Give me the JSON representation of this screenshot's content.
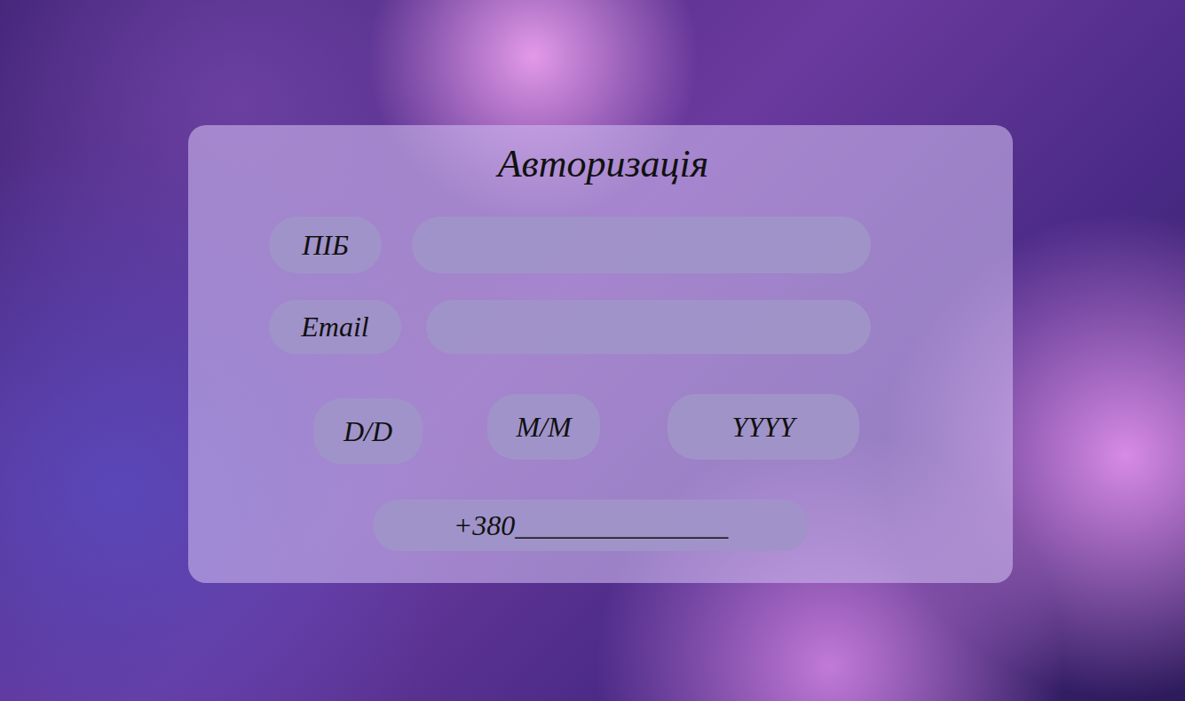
{
  "form": {
    "title": "Авторизація",
    "fields": [
      {
        "label": "ПІБ",
        "value": ""
      },
      {
        "label": "Email",
        "value": ""
      }
    ],
    "date": [
      {
        "placeholder": "D/D"
      },
      {
        "placeholder": "M/M"
      },
      {
        "placeholder": "YYYY"
      }
    ],
    "phone": {
      "placeholder": "+380_______________"
    }
  }
}
